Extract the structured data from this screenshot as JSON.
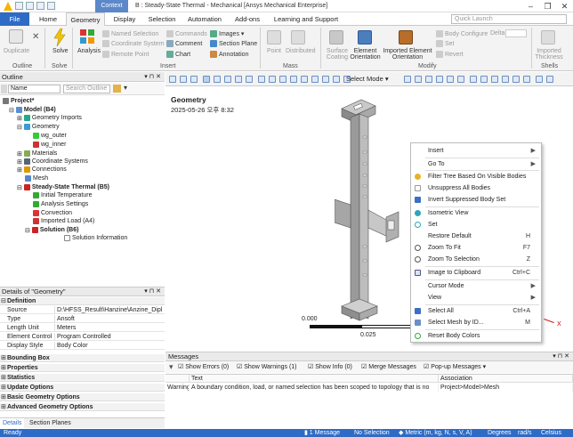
{
  "titlebar": {
    "context_tab": "Context",
    "title": "B : Steady-State Thermal - Mechanical [Ansys Mechanical Enterprise]",
    "controls": [
      "–",
      "❐",
      "✕"
    ]
  },
  "tabs": {
    "file": "File",
    "items": [
      "Home",
      "Geometry",
      "Display",
      "Selection",
      "Automation",
      "Add-ons",
      "Learning and Support"
    ],
    "active": "Geometry",
    "quick_launch_placeholder": "Quick Launch"
  },
  "ribbon": {
    "outline": {
      "duplicate": "Duplicate",
      "label": "Outline"
    },
    "solve": {
      "solve": "Solve",
      "label": "Solve"
    },
    "insert": {
      "analysis": "Analysis",
      "named_selection": "Named Selection",
      "coordinate_system": "Coordinate System",
      "remote_point": "Remote Point",
      "commands": "Commands",
      "comment": "Comment",
      "chart": "Chart",
      "images": "Images",
      "section_plane": "Section Plane",
      "annotation": "Annotation",
      "label": "Insert"
    },
    "mass": {
      "point": "Point",
      "distributed": "Distributed",
      "label": "Mass"
    },
    "modify": {
      "surface_coating": "Surface Coating",
      "element_orientation": "Element Orientation",
      "imported_element_orientation": "Imported Element Orientation",
      "body_configure": "Body Configure",
      "delta": "Delta",
      "set": "Set",
      "revert": "Revert",
      "label": "Modify"
    },
    "shells": {
      "imported_thickness": "Imported Thickness",
      "label": "Shells"
    }
  },
  "outline": {
    "title": "Outline",
    "name_dropdown": "Name",
    "search_placeholder": "Search Outline",
    "tree": [
      {
        "label": "Project*",
        "level": 0,
        "bold": true
      },
      {
        "label": "Model (B4)",
        "level": 1,
        "bold": true
      },
      {
        "label": "Geometry Imports",
        "level": 2
      },
      {
        "label": "Geometry",
        "level": 2
      },
      {
        "label": "wg_outer",
        "level": 3
      },
      {
        "label": "wg_inner",
        "level": 3
      },
      {
        "label": "Materials",
        "level": 2
      },
      {
        "label": "Coordinate Systems",
        "level": 2
      },
      {
        "label": "Connections",
        "level": 2
      },
      {
        "label": "Mesh",
        "level": 2
      },
      {
        "label": "Steady-State Thermal (B5)",
        "level": 2,
        "bold": true
      },
      {
        "label": "Initial Temperature",
        "level": 3
      },
      {
        "label": "Analysis Settings",
        "level": 3
      },
      {
        "label": "Convection",
        "level": 3
      },
      {
        "label": "Imported Load (A4)",
        "level": 3
      },
      {
        "label": "Solution (B6)",
        "level": 3,
        "bold": true
      },
      {
        "label": "Solution Information",
        "level": 4
      }
    ]
  },
  "details": {
    "title": "Details of \"Geometry\"",
    "definition_label": "Definition",
    "rows": [
      {
        "k": "Source",
        "v": "D:\\HFSS_Result\\Hanzine\\Anzine_Dipl..."
      },
      {
        "k": "Type",
        "v": "Ansoft"
      },
      {
        "k": "Length Unit",
        "v": "Meters"
      },
      {
        "k": "Element Control",
        "v": "Program Controlled"
      },
      {
        "k": "Display Style",
        "v": "Body Color"
      }
    ],
    "sections": [
      "Bounding Box",
      "Properties",
      "Statistics",
      "Update Options",
      "Basic Geometry Options",
      "Advanced Geometry Options"
    ]
  },
  "bottom_tabs": [
    "Details",
    "Section Planes"
  ],
  "viewport": {
    "title": "Geometry",
    "date": "2025-05-26 오후 8:32",
    "toolbar_select": "Select",
    "toolbar_mode": "Mode",
    "scale_start": "0.000",
    "scale_mid": "0.025",
    "axis_x": "X"
  },
  "context_menu": [
    {
      "label": "Insert",
      "submenu": true
    },
    {
      "label": "Go To",
      "submenu": true
    },
    {
      "label": "Filter Tree Based On Visible Bodies"
    },
    {
      "label": "Unsuppress All Bodies"
    },
    {
      "label": "Invert Suppressed Body Set"
    },
    {
      "label": "Isometric View"
    },
    {
      "label": "Set"
    },
    {
      "label": "Restore Default",
      "shortcut": "H"
    },
    {
      "label": "Zoom To Fit",
      "shortcut": "F7"
    },
    {
      "label": "Zoom To Selection",
      "shortcut": "Z"
    },
    {
      "label": "Image to Clipboard",
      "shortcut": "Ctrl+C"
    },
    {
      "label": "Cursor Mode",
      "submenu": true
    },
    {
      "label": "View",
      "submenu": true
    },
    {
      "label": "Select All",
      "shortcut": "Ctrl+A"
    },
    {
      "label": "Select Mesh by ID...",
      "shortcut": "M"
    },
    {
      "label": "Reset Body Colors"
    }
  ],
  "messages": {
    "title": "Messages",
    "filters": {
      "errors": "Show Errors",
      "errors_count": "(0)",
      "warnings": "Show Warnings",
      "warnings_count": "(1)",
      "info": "Show Info",
      "info_count": "(0)",
      "merge": "Merge Messages",
      "popup": "Pop-up Messages"
    },
    "columns": [
      "Text",
      "Association"
    ],
    "rows": [
      {
        "type": "Warning",
        "text": "A boundary condition, load, or named selection has been scoped to topology that is no",
        "assoc": "Project>Model>Mesh"
      }
    ]
  },
  "statusbar": {
    "ready": "Ready",
    "messages": "1 Message",
    "selection": "No Selection",
    "units": "Metric (m, kg, N, s, V, A)",
    "degrees": "Degrees",
    "rads": "rad/s",
    "celsius": "Celsius"
  }
}
